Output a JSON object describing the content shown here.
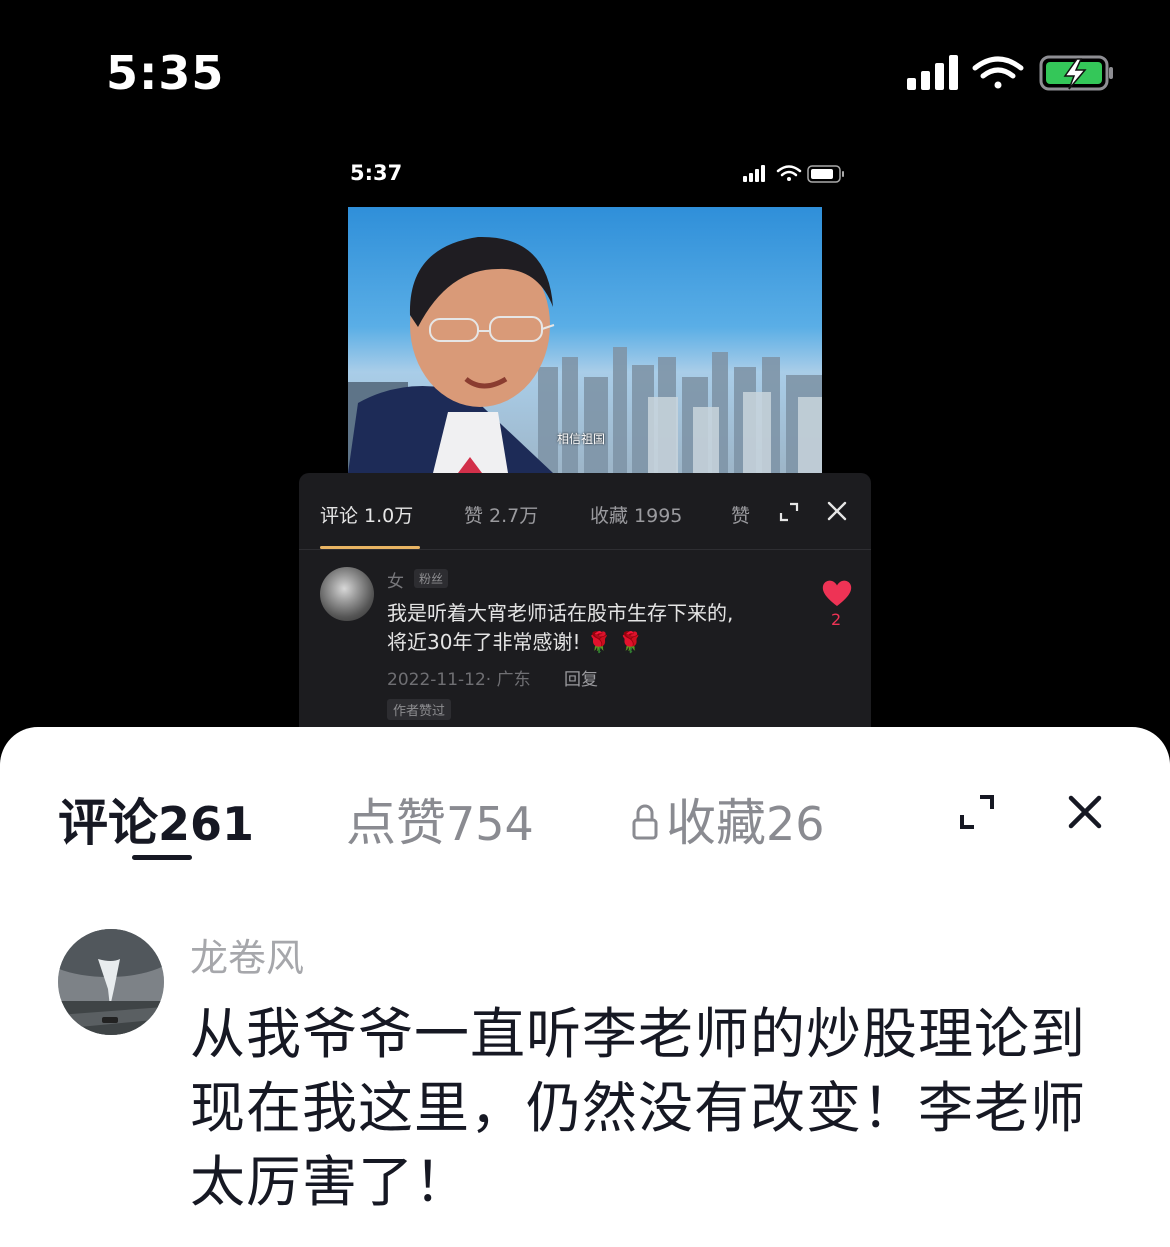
{
  "status_bar": {
    "time": "5:35",
    "battery_color": "#34c759"
  },
  "inner_screenshot": {
    "status_time": "5:37",
    "video_caption": "相信祖国",
    "tabs": {
      "comments": "评论 1.0万",
      "likes": "赞 2.7万",
      "favorites": "收藏 1995",
      "more": "赞"
    },
    "accent_color": "#e8b463",
    "comment": {
      "username": "女",
      "badge": "粉丝",
      "line1": "我是听着大宵老师话在股市生存下来的,",
      "line2": "将近30年了非常感谢! 🌹 🌹",
      "meta": "2022-11-12· 广东",
      "reply": "回复",
      "author_tag": "作者赞过",
      "likes": "2",
      "heart_color": "#ee3355"
    }
  },
  "sheet": {
    "tabs": {
      "comments_label": "评论",
      "comments_count": "261",
      "likes_label": "点赞",
      "likes_count": "754",
      "favorites_label": "收藏",
      "favorites_count": "26"
    },
    "icons": [
      "lock-icon",
      "expand-icon",
      "close-icon"
    ],
    "comment": {
      "username": "龙卷风",
      "line1": "从我爷爷一直听李老师的炒股理论到",
      "line2": "现在我这里，仍然没有改变！李老师",
      "line3": "太厉害了！"
    }
  }
}
